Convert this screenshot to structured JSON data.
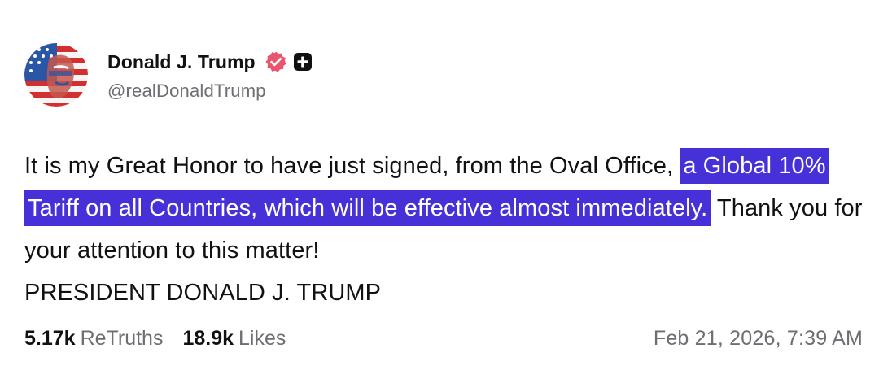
{
  "author": {
    "display_name": "Donald J. Trump",
    "handle": "@realDonaldTrump",
    "avatar_icon": "flag-portrait-avatar",
    "verified_icon": "verified-badge-icon",
    "plus_icon": "plus-badge-icon"
  },
  "post": {
    "text_before": "It is my Great Honor to have just signed, from the Oval Office, ",
    "text_highlight": "a Global 10% Tariff on all Countries, which will be effective almost immediately.",
    "text_after": " Thank you for your attention to this matter!",
    "signature": "PRESIDENT DONALD J. TRUMP",
    "highlight_color": "#4631d9"
  },
  "stats": {
    "retruths_count": "5.17k",
    "retruths_label": "ReTruths",
    "likes_count": "18.9k",
    "likes_label": "Likes"
  },
  "timestamp": "Feb 21, 2026, 7:39 AM"
}
